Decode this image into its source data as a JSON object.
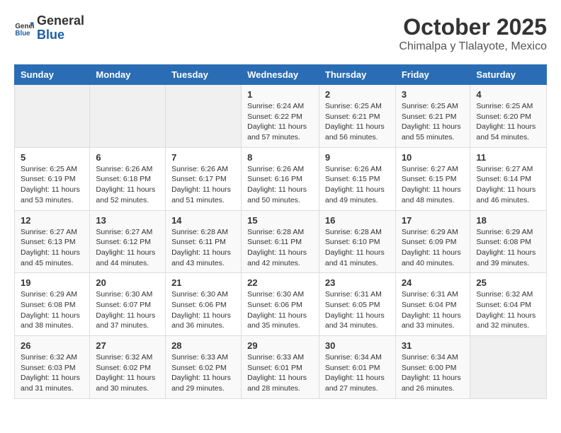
{
  "header": {
    "logo_line1": "General",
    "logo_line2": "Blue",
    "month": "October 2025",
    "location": "Chimalpa y Tlalayote, Mexico"
  },
  "weekdays": [
    "Sunday",
    "Monday",
    "Tuesday",
    "Wednesday",
    "Thursday",
    "Friday",
    "Saturday"
  ],
  "weeks": [
    [
      {
        "day": "",
        "info": ""
      },
      {
        "day": "",
        "info": ""
      },
      {
        "day": "",
        "info": ""
      },
      {
        "day": "1",
        "info": "Sunrise: 6:24 AM\nSunset: 6:22 PM\nDaylight: 11 hours and 57 minutes."
      },
      {
        "day": "2",
        "info": "Sunrise: 6:25 AM\nSunset: 6:21 PM\nDaylight: 11 hours and 56 minutes."
      },
      {
        "day": "3",
        "info": "Sunrise: 6:25 AM\nSunset: 6:21 PM\nDaylight: 11 hours and 55 minutes."
      },
      {
        "day": "4",
        "info": "Sunrise: 6:25 AM\nSunset: 6:20 PM\nDaylight: 11 hours and 54 minutes."
      }
    ],
    [
      {
        "day": "5",
        "info": "Sunrise: 6:25 AM\nSunset: 6:19 PM\nDaylight: 11 hours and 53 minutes."
      },
      {
        "day": "6",
        "info": "Sunrise: 6:26 AM\nSunset: 6:18 PM\nDaylight: 11 hours and 52 minutes."
      },
      {
        "day": "7",
        "info": "Sunrise: 6:26 AM\nSunset: 6:17 PM\nDaylight: 11 hours and 51 minutes."
      },
      {
        "day": "8",
        "info": "Sunrise: 6:26 AM\nSunset: 6:16 PM\nDaylight: 11 hours and 50 minutes."
      },
      {
        "day": "9",
        "info": "Sunrise: 6:26 AM\nSunset: 6:15 PM\nDaylight: 11 hours and 49 minutes."
      },
      {
        "day": "10",
        "info": "Sunrise: 6:27 AM\nSunset: 6:15 PM\nDaylight: 11 hours and 48 minutes."
      },
      {
        "day": "11",
        "info": "Sunrise: 6:27 AM\nSunset: 6:14 PM\nDaylight: 11 hours and 46 minutes."
      }
    ],
    [
      {
        "day": "12",
        "info": "Sunrise: 6:27 AM\nSunset: 6:13 PM\nDaylight: 11 hours and 45 minutes."
      },
      {
        "day": "13",
        "info": "Sunrise: 6:27 AM\nSunset: 6:12 PM\nDaylight: 11 hours and 44 minutes."
      },
      {
        "day": "14",
        "info": "Sunrise: 6:28 AM\nSunset: 6:11 PM\nDaylight: 11 hours and 43 minutes."
      },
      {
        "day": "15",
        "info": "Sunrise: 6:28 AM\nSunset: 6:11 PM\nDaylight: 11 hours and 42 minutes."
      },
      {
        "day": "16",
        "info": "Sunrise: 6:28 AM\nSunset: 6:10 PM\nDaylight: 11 hours and 41 minutes."
      },
      {
        "day": "17",
        "info": "Sunrise: 6:29 AM\nSunset: 6:09 PM\nDaylight: 11 hours and 40 minutes."
      },
      {
        "day": "18",
        "info": "Sunrise: 6:29 AM\nSunset: 6:08 PM\nDaylight: 11 hours and 39 minutes."
      }
    ],
    [
      {
        "day": "19",
        "info": "Sunrise: 6:29 AM\nSunset: 6:08 PM\nDaylight: 11 hours and 38 minutes."
      },
      {
        "day": "20",
        "info": "Sunrise: 6:30 AM\nSunset: 6:07 PM\nDaylight: 11 hours and 37 minutes."
      },
      {
        "day": "21",
        "info": "Sunrise: 6:30 AM\nSunset: 6:06 PM\nDaylight: 11 hours and 36 minutes."
      },
      {
        "day": "22",
        "info": "Sunrise: 6:30 AM\nSunset: 6:06 PM\nDaylight: 11 hours and 35 minutes."
      },
      {
        "day": "23",
        "info": "Sunrise: 6:31 AM\nSunset: 6:05 PM\nDaylight: 11 hours and 34 minutes."
      },
      {
        "day": "24",
        "info": "Sunrise: 6:31 AM\nSunset: 6:04 PM\nDaylight: 11 hours and 33 minutes."
      },
      {
        "day": "25",
        "info": "Sunrise: 6:32 AM\nSunset: 6:04 PM\nDaylight: 11 hours and 32 minutes."
      }
    ],
    [
      {
        "day": "26",
        "info": "Sunrise: 6:32 AM\nSunset: 6:03 PM\nDaylight: 11 hours and 31 minutes."
      },
      {
        "day": "27",
        "info": "Sunrise: 6:32 AM\nSunset: 6:02 PM\nDaylight: 11 hours and 30 minutes."
      },
      {
        "day": "28",
        "info": "Sunrise: 6:33 AM\nSunset: 6:02 PM\nDaylight: 11 hours and 29 minutes."
      },
      {
        "day": "29",
        "info": "Sunrise: 6:33 AM\nSunset: 6:01 PM\nDaylight: 11 hours and 28 minutes."
      },
      {
        "day": "30",
        "info": "Sunrise: 6:34 AM\nSunset: 6:01 PM\nDaylight: 11 hours and 27 minutes."
      },
      {
        "day": "31",
        "info": "Sunrise: 6:34 AM\nSunset: 6:00 PM\nDaylight: 11 hours and 26 minutes."
      },
      {
        "day": "",
        "info": ""
      }
    ]
  ]
}
